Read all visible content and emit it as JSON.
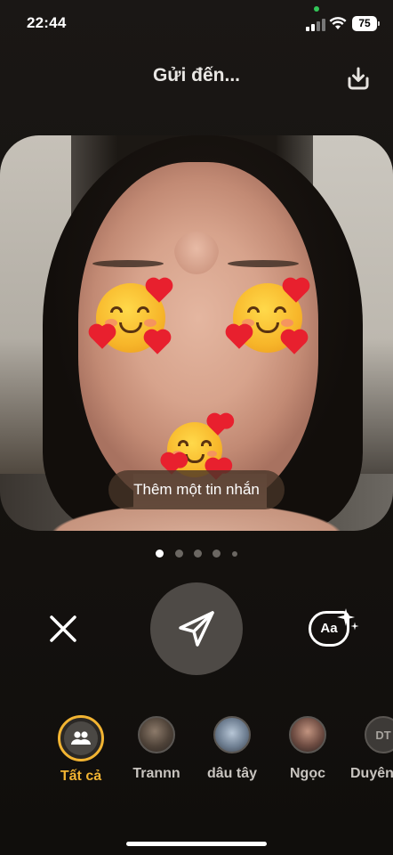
{
  "status_bar": {
    "time": "22:44",
    "battery": "75",
    "icons": [
      "signal-icon",
      "wifi-icon",
      "battery-icon"
    ]
  },
  "header": {
    "title": "Gửi đến...",
    "download_icon": "download-icon"
  },
  "photo": {
    "message_placeholder": "Thêm một tin nhắn"
  },
  "pagination": {
    "count": 5,
    "active_index": 0
  },
  "controls": {
    "close_icon": "close-icon",
    "send_icon": "send-icon",
    "text_style_label": "Aa",
    "text_style_icon": "sparkle-text-icon"
  },
  "recipients": [
    {
      "label": "Tất cả",
      "avatar": "group-icon",
      "selected": true
    },
    {
      "label": "Trannn",
      "avatar": "photo",
      "selected": false
    },
    {
      "label": "dâu tây",
      "avatar": "photo",
      "selected": false
    },
    {
      "label": "Ngọc",
      "avatar": "photo",
      "selected": false
    },
    {
      "label": "Duyên",
      "avatar": "DT",
      "selected": false
    }
  ],
  "colors": {
    "accent": "#f2b432",
    "background": "#141210",
    "send_button": "#4e4a46"
  }
}
